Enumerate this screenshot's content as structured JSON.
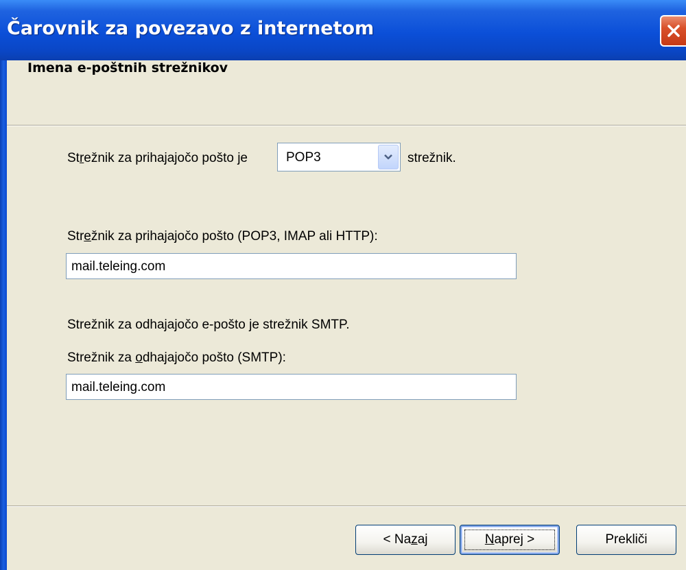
{
  "window": {
    "title": "Čarovnik za povezavo z internetom"
  },
  "header": {
    "title": "Imena e-poštnih strežnikov"
  },
  "incoming_type": {
    "prefix_before": "St",
    "prefix_access": "r",
    "prefix_after": "ežnik za prihajajočo pošto je",
    "selected": "POP3",
    "suffix": "strežnik."
  },
  "incoming_server": {
    "label_before": "Str",
    "label_access": "e",
    "label_after": "žnik za prihajajočo pošto (POP3, IMAP ali HTTP):",
    "value": "mail.teleing.com"
  },
  "outgoing_info": "Strežnik za odhajajočo e-pošto je strežnik SMTP.",
  "outgoing_server": {
    "label_before": "Strežnik za ",
    "label_access": "o",
    "label_after": "dhajajočo pošto (SMTP):",
    "value": "mail.teleing.com"
  },
  "buttons": {
    "back_before": "< Na",
    "back_access": "z",
    "back_after": "aj",
    "next_access": "N",
    "next_after": "aprej >",
    "cancel": "Prekliči"
  },
  "icons": {
    "close": "close-icon",
    "dropdown": "chevron-down-icon"
  },
  "colors": {
    "titlebar": "#0b4fd8",
    "close_button": "#d9502a",
    "dialog_background": "#ece9d8",
    "input_border": "#7f9db9"
  }
}
